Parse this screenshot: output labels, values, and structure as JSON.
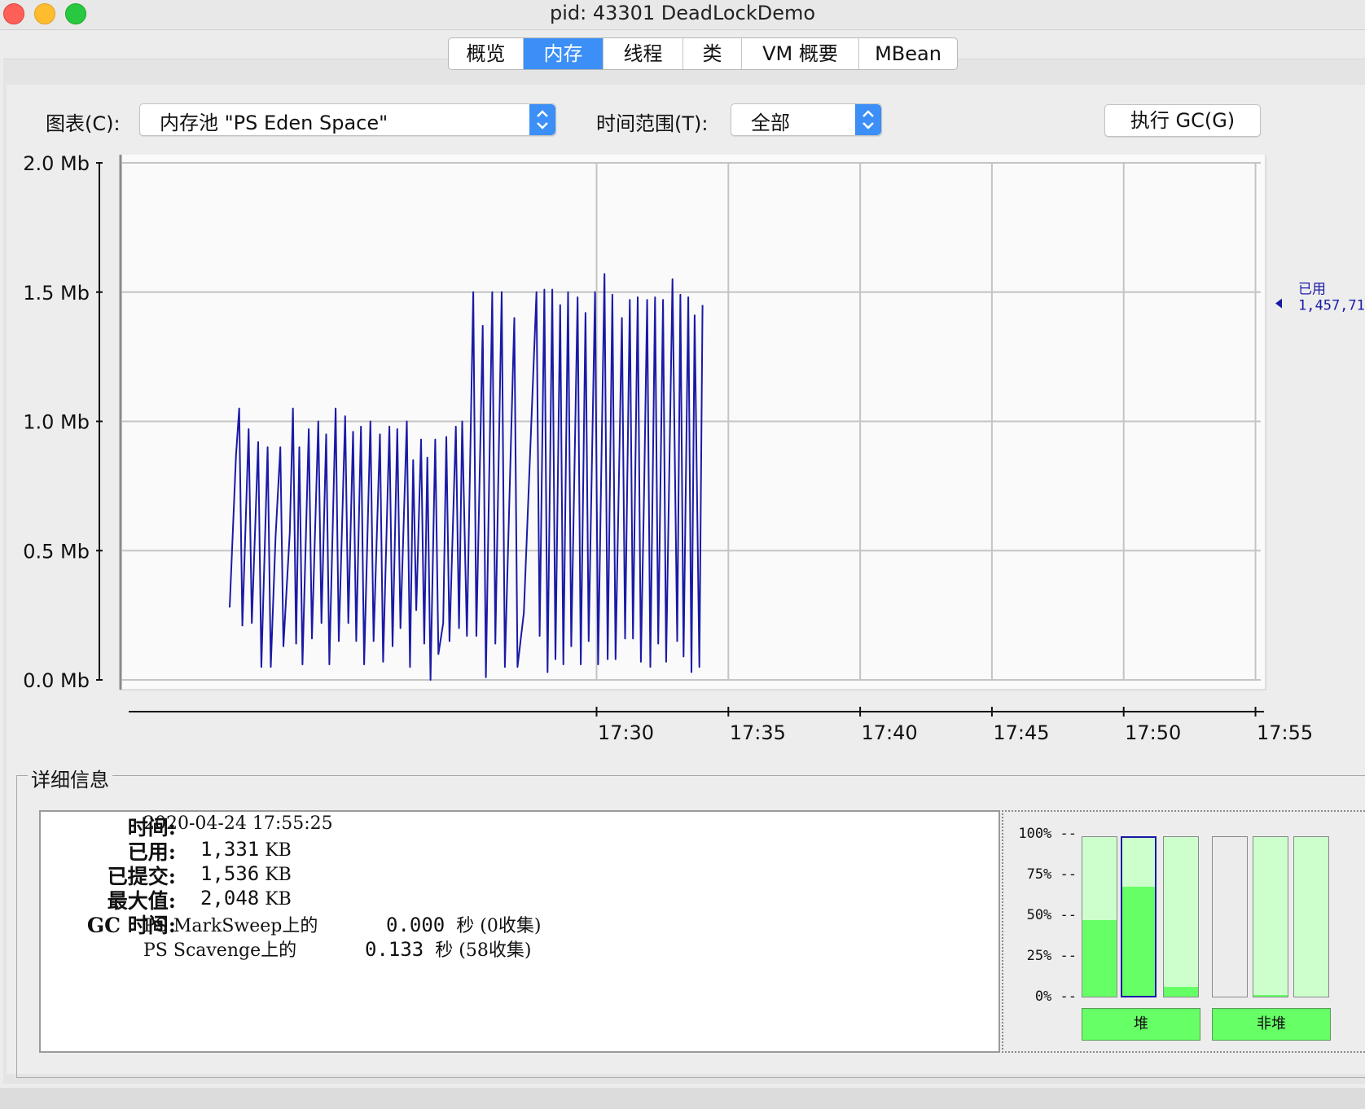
{
  "window": {
    "title": "pid: 43301 DeadLockDemo"
  },
  "tabs": [
    "概览",
    "内存",
    "线程",
    "类",
    "VM 概要",
    "MBean"
  ],
  "toolbar": {
    "chart_label": "图表(C):",
    "chart_value": "内存池 \"PS Eden Space\"",
    "range_label": "时间范围(T):",
    "range_value": "全部",
    "gc_button": "执行 GC(G)"
  },
  "chart_data": {
    "type": "line",
    "ylabel": "",
    "xlabel": "",
    "y_ticks": [
      "0.0 Mb",
      "0.5 Mb",
      "1.0 Mb",
      "1.5 Mb",
      "2.0 Mb"
    ],
    "ylim": [
      0,
      2.0
    ],
    "x_ticks": [
      "17:30",
      "17:35",
      "17:40",
      "17:45",
      "17:50",
      "17:55"
    ],
    "xlim_minutes": [
      17.2,
      17.92
    ],
    "grid": true,
    "series": [
      {
        "name": "已用",
        "color": "#1a1aa6",
        "current_label": "1,457,71",
        "points": [
          [
            17.268,
            0.28
          ],
          [
            17.272,
            0.87
          ],
          [
            17.274,
            1.05
          ],
          [
            17.276,
            0.21
          ],
          [
            17.28,
            0.97
          ],
          [
            17.282,
            0.22
          ],
          [
            17.286,
            0.92
          ],
          [
            17.288,
            0.05
          ],
          [
            17.292,
            0.9
          ],
          [
            17.294,
            0.05
          ],
          [
            17.297,
            0.55
          ],
          [
            17.3,
            0.9
          ],
          [
            17.302,
            0.13
          ],
          [
            17.306,
            0.57
          ],
          [
            17.308,
            1.05
          ],
          [
            17.31,
            0.14
          ],
          [
            17.312,
            0.9
          ],
          [
            17.314,
            0.06
          ],
          [
            17.318,
            0.97
          ],
          [
            17.32,
            0.16
          ],
          [
            17.324,
            1.0
          ],
          [
            17.326,
            0.22
          ],
          [
            17.329,
            0.95
          ],
          [
            17.331,
            0.06
          ],
          [
            17.335,
            1.05
          ],
          [
            17.337,
            0.15
          ],
          [
            17.341,
            1.02
          ],
          [
            17.343,
            0.22
          ],
          [
            17.346,
            0.96
          ],
          [
            17.348,
            0.15
          ],
          [
            17.351,
            0.98
          ],
          [
            17.353,
            0.06
          ],
          [
            17.357,
            1.0
          ],
          [
            17.359,
            0.15
          ],
          [
            17.363,
            0.95
          ],
          [
            17.365,
            0.07
          ],
          [
            17.369,
            0.98
          ],
          [
            17.371,
            0.13
          ],
          [
            17.374,
            0.97
          ],
          [
            17.376,
            0.2
          ],
          [
            17.38,
            1.0
          ],
          [
            17.382,
            0.05
          ],
          [
            17.384,
            0.85
          ],
          [
            17.386,
            0.27
          ],
          [
            17.389,
            0.93
          ],
          [
            17.391,
            0.14
          ],
          [
            17.393,
            0.86
          ],
          [
            17.395,
            0.0
          ],
          [
            17.398,
            0.93
          ],
          [
            17.4,
            0.1
          ],
          [
            17.403,
            0.22
          ],
          [
            17.405,
            0.94
          ],
          [
            17.407,
            0.15
          ],
          [
            17.411,
            0.98
          ],
          [
            17.413,
            0.2
          ],
          [
            17.415,
            1.0
          ],
          [
            17.418,
            0.17
          ],
          [
            17.422,
            1.5
          ],
          [
            17.424,
            0.17
          ],
          [
            17.428,
            1.37
          ],
          [
            17.43,
            0.01
          ],
          [
            17.434,
            1.5
          ],
          [
            17.436,
            0.14
          ],
          [
            17.44,
            1.5
          ],
          [
            17.442,
            0.05
          ],
          [
            17.448,
            1.4
          ],
          [
            17.45,
            0.05
          ],
          [
            17.454,
            0.26
          ],
          [
            17.462,
            1.5
          ],
          [
            17.464,
            0.17
          ],
          [
            17.467,
            1.51
          ],
          [
            17.469,
            0.03
          ],
          [
            17.472,
            1.51
          ],
          [
            17.474,
            0.08
          ],
          [
            17.477,
            1.45
          ],
          [
            17.479,
            0.06
          ],
          [
            17.482,
            1.5
          ],
          [
            17.484,
            0.13
          ],
          [
            17.488,
            1.48
          ],
          [
            17.49,
            0.06
          ],
          [
            17.493,
            1.42
          ],
          [
            17.495,
            0.15
          ],
          [
            17.499,
            1.5
          ],
          [
            17.501,
            0.06
          ],
          [
            17.505,
            1.57
          ],
          [
            17.507,
            0.08
          ],
          [
            17.51,
            1.49
          ],
          [
            17.512,
            0.08
          ],
          [
            17.516,
            1.4
          ],
          [
            17.518,
            0.16
          ],
          [
            17.521,
            1.47
          ],
          [
            17.523,
            0.16
          ],
          [
            17.526,
            1.48
          ],
          [
            17.528,
            0.07
          ],
          [
            17.53,
            0.72
          ],
          [
            17.532,
            1.47
          ],
          [
            17.534,
            0.05
          ],
          [
            17.537,
            1.48
          ],
          [
            17.539,
            0.14
          ],
          [
            17.542,
            1.47
          ],
          [
            17.544,
            0.07
          ],
          [
            17.548,
            1.55
          ],
          [
            17.551,
            0.15
          ],
          [
            17.553,
            1.49
          ],
          [
            17.555,
            0.09
          ],
          [
            17.558,
            1.48
          ],
          [
            17.56,
            0.03
          ],
          [
            17.562,
            1.41
          ],
          [
            17.565,
            0.05
          ],
          [
            17.567,
            1.45
          ]
        ]
      }
    ]
  },
  "details": {
    "title": "详细信息",
    "time_label": "时间:",
    "time_value": "2020-04-24 17:55:25",
    "used_label": "已用:",
    "used_num": "1,331",
    "used_unit": "KB",
    "committed_label": "已提交:",
    "committed_num": "1,536",
    "committed_unit": "KB",
    "max_label": "最大值:",
    "max_num": "2,048",
    "max_unit": "KB",
    "gc_label": "GC 时间:",
    "gc1_name": "PS MarkSweep上的",
    "gc1_time": "0.000",
    "gc1_unit": "秒 (0收集)",
    "gc2_name": "PS Scavenge上的",
    "gc2_time": "0.133",
    "gc2_unit": "秒 (58收集)"
  },
  "pools": {
    "ticks": [
      "100% --",
      "75% --",
      "50% --",
      "25% --",
      "0% --"
    ],
    "heap_label": "堆",
    "nonheap_label": "非堆",
    "heap_levels": [
      0.48,
      0.69,
      0.06
    ],
    "nonheap_levels": [
      0.0,
      0.01,
      0.0
    ],
    "selected_index": 1
  }
}
